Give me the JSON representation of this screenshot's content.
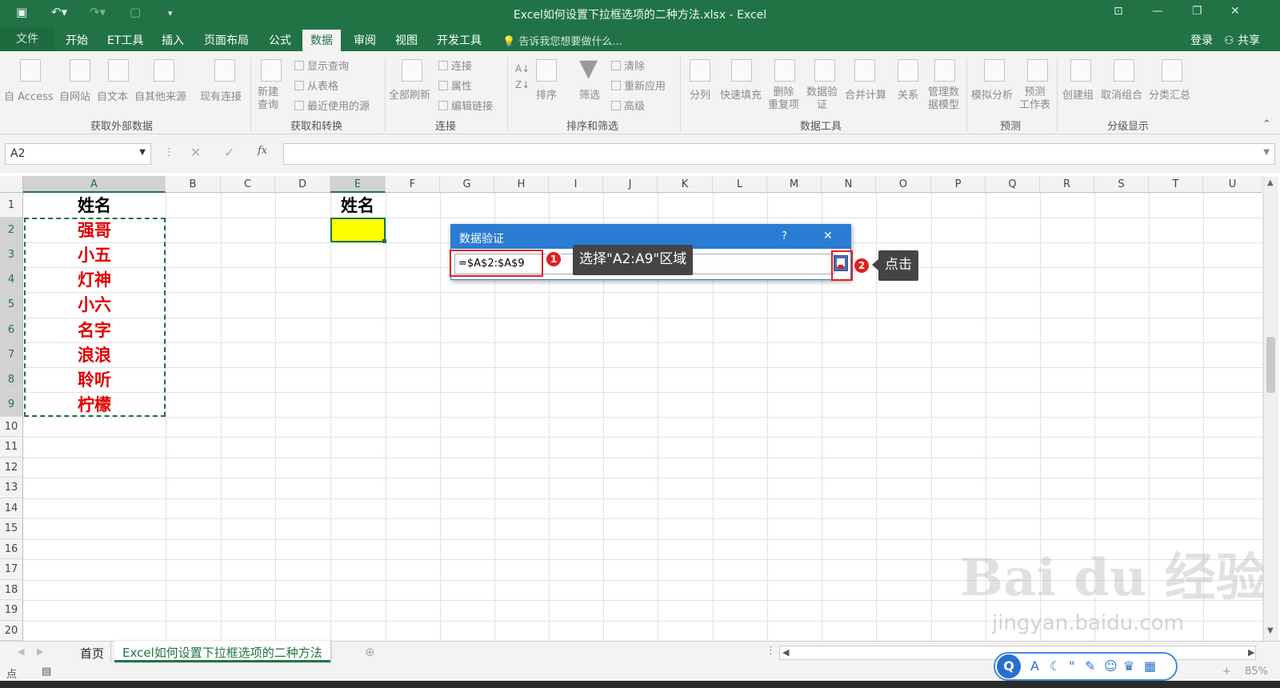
{
  "window": {
    "title": "Excel如何设置下拉框选项的二种方法.xlsx - Excel"
  },
  "tabs": [
    "文件",
    "开始",
    "ET工具",
    "插入",
    "页面布局",
    "公式",
    "数据",
    "审阅",
    "视图",
    "开发工具"
  ],
  "tell_me": "告诉我您想要做什么...",
  "account": {
    "login": "登录",
    "share": "共享"
  },
  "ribbon": {
    "ext": [
      "自 Access",
      "自网站",
      "自文本",
      "自其他来源",
      "现有连接"
    ],
    "new_query": "新建\n查询",
    "small1": [
      "显示查询",
      "从表格",
      "最近使用的源"
    ],
    "refresh": "全部刷新",
    "small2": [
      "连接",
      "属性",
      "编辑链接"
    ],
    "sort": "排序",
    "filter": "筛选",
    "small3": [
      "清除",
      "重新应用",
      "高级"
    ],
    "tools": [
      "分列",
      "快速填充",
      "删除\n重复项",
      "数据验\n证",
      "合并计算",
      "关系",
      "管理数\n据模型"
    ],
    "forecast": [
      "模拟分析",
      "预测\n工作表"
    ],
    "outline": [
      "创建组",
      "取消组合",
      "分类汇总"
    ],
    "groups": [
      "获取外部数据",
      "获取和转换",
      "连接",
      "排序和筛选",
      "数据工具",
      "预测",
      "分级显示"
    ]
  },
  "namebox": "A2",
  "fx": "fx",
  "columns": [
    "A",
    "B",
    "C",
    "D",
    "E",
    "F",
    "G",
    "H",
    "I",
    "J",
    "K",
    "L",
    "M",
    "N",
    "O",
    "P",
    "Q",
    "R",
    "S",
    "T",
    "U"
  ],
  "rows": [
    "1",
    "2",
    "3",
    "4",
    "5",
    "6",
    "7",
    "8",
    "9",
    "10",
    "11",
    "12",
    "13",
    "14",
    "15",
    "16",
    "17",
    "18",
    "19",
    "20"
  ],
  "cells": {
    "a1": "姓名",
    "e1": "姓名",
    "names": [
      "强哥",
      "小五",
      "灯神",
      "小六",
      "名字",
      "浪浪",
      "聆听",
      "柠檬"
    ]
  },
  "dialog": {
    "title": "数据验证",
    "help": "?",
    "close": "✕",
    "input": "=$A$2:$A$9"
  },
  "callouts": {
    "one_num": "1",
    "one": "选择\"A2:A9\"区域",
    "two_num": "2",
    "two": "点击"
  },
  "sheets": [
    "首页",
    "Excel如何设置下拉框选项的二种方法"
  ],
  "status": {
    "mode": "点",
    "zoom": "85%"
  },
  "watermark": {
    "brand": "Bai du 经验",
    "url": "jingyan.baidu.com"
  }
}
